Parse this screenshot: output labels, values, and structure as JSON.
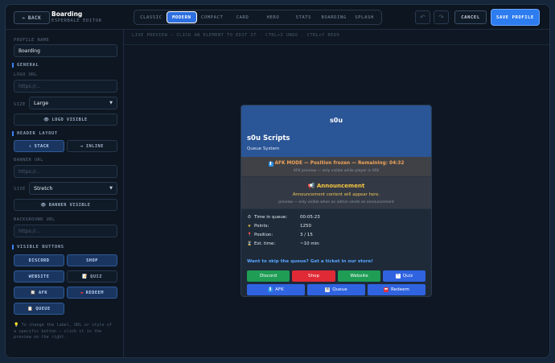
{
  "topbar": {
    "back_label": "BACK",
    "title": "Boarding",
    "subtitle": "ESPERBALE EDITOR",
    "tabs": [
      "CLASSIC",
      "MODERN",
      "COMPACT",
      "CARD",
      "HERO",
      "STATS",
      "BOARDING",
      "SPLASH"
    ],
    "active_tab": "MODERN",
    "undo_icon": "undo-icon",
    "redo_icon": "redo-icon",
    "cancel_label": "CANCEL",
    "save_label": "SAVE PROFILE"
  },
  "sidebar": {
    "profile_name_label": "PROFILE NAME",
    "profile_name_value": "Boarding",
    "general_heading": "GENERAL",
    "logo_url_label": "LOGO URL",
    "logo_url_placeholder": "https://...",
    "size_label": "SIZE",
    "logo_size_value": "Large",
    "logo_visible_label": "LOGO VISIBLE",
    "header_layout_heading": "HEADER LAYOUT",
    "stack_label": "STACK",
    "inline_label": "INLINE",
    "banner_url_label": "BANNER URL",
    "banner_url_placeholder": "https://...",
    "banner_size_label": "SIZE",
    "banner_size_value": "Stretch",
    "banner_visible_label": "BANNER VISIBLE",
    "background_url_label": "BACKGROUND URL",
    "background_url_placeholder": "https://...",
    "visible_buttons_heading": "VISIBLE BUTTONS",
    "buttons": [
      "DISCORD",
      "SHOP",
      "WEBSITE",
      "QUIZ",
      "AFK",
      "REDEEM",
      "QUEUE"
    ],
    "tip": "To change the label, URL or style of a specific button — click it in the preview on the right."
  },
  "preview": {
    "hint": "LIVE PREVIEW — CLICK AN ELEMENT TO EDIT IT · CTRL+Z UNDO · CTRL+Y REDO"
  },
  "card": {
    "logo_text": "s0u",
    "title": "s0u Scripts",
    "subtitle": "Queue System",
    "afk_title": "AFK MODE — Position frozen — Remaining: 04:32",
    "afk_note": "AFK preview — only visible while player is AFK",
    "announcement_title": "Announcement",
    "announcement_text": "Announcement content will appear here.",
    "announcement_note": "preview — only visible when an admin sends an announcement",
    "stats": [
      {
        "label": "Time in queue:",
        "value": "00:05:23",
        "icon": "stopwatch-icon"
      },
      {
        "label": "Points:",
        "value": "1250",
        "icon": "star-icon"
      },
      {
        "label": "Position:",
        "value": "3 / 15",
        "icon": "pin-icon"
      },
      {
        "label": "Est. time:",
        "value": "~10 min",
        "icon": "hourglass-icon"
      }
    ],
    "cta": "Want to skip the queue? Get a ticket in our store!",
    "buttons_row1": [
      "Discord",
      "Shop",
      "Website",
      "Quiz"
    ],
    "buttons_row2": [
      "AFK",
      "Queue",
      "Redeem"
    ]
  },
  "colors": {
    "accent": "#2d7cf0",
    "discord": "#1f9d55",
    "shop": "#e02a35",
    "website": "#1f9d55",
    "quiz": "#2f63e0",
    "afk": "#2f63e0",
    "queue": "#2f63e0",
    "redeem": "#2f63e0"
  }
}
